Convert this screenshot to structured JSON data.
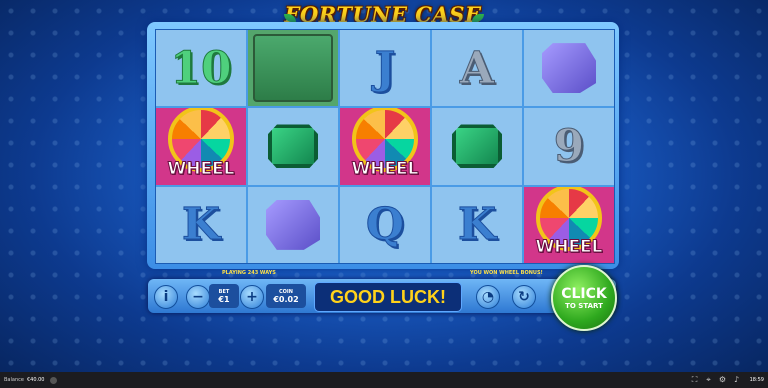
{
  "game": {
    "title": "FORTUNE CASE"
  },
  "reels": [
    [
      {
        "type": "ten",
        "label": "10"
      },
      {
        "type": "wheel",
        "label": "WHEEL"
      },
      {
        "type": "king",
        "label": "K"
      }
    ],
    [
      {
        "type": "case",
        "label": ""
      },
      {
        "type": "emerald",
        "label": ""
      },
      {
        "type": "cube",
        "label": ""
      }
    ],
    [
      {
        "type": "jack",
        "label": "J"
      },
      {
        "type": "wheel",
        "label": "WHEEL"
      },
      {
        "type": "queen",
        "label": "Q"
      }
    ],
    [
      {
        "type": "ace",
        "label": "A"
      },
      {
        "type": "emerald",
        "label": ""
      },
      {
        "type": "king",
        "label": "K"
      }
    ],
    [
      {
        "type": "cube",
        "label": ""
      },
      {
        "type": "nine",
        "label": "9"
      },
      {
        "type": "wheel",
        "label": "WHEEL"
      }
    ]
  ],
  "panel": {
    "ways_caption": "PLAYING 243 WAYS",
    "bonus_caption": "YOU WON WHEEL BONUS!",
    "bet_label": "BET",
    "bet_value": "€1",
    "coin_label": "COIN",
    "coin_value": "€0.02",
    "message": "GOOD LUCK!",
    "start_big": "CLICK",
    "start_small": "TO START"
  },
  "bottom_bar": {
    "balance_label": "Balance",
    "balance_value": "€40.00",
    "time": "18:59"
  }
}
